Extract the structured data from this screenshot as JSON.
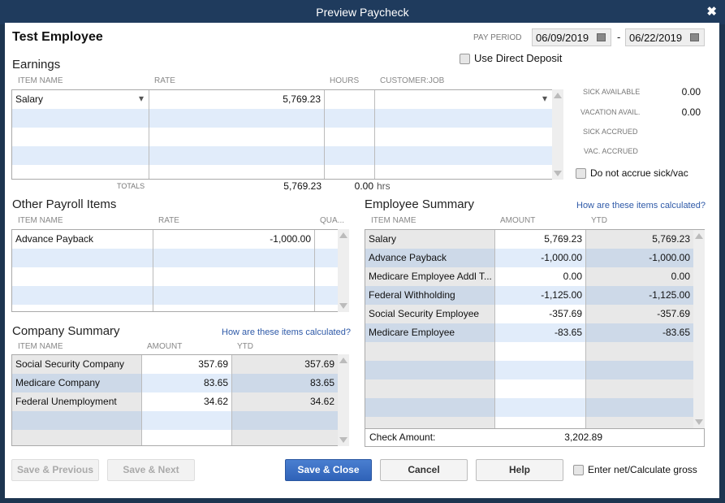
{
  "window": {
    "title": "Preview Paycheck",
    "close": "✖"
  },
  "employee_name": "Test Employee",
  "pay_period": {
    "label": "PAY PERIOD",
    "start": "06/09/2019",
    "sep": "-",
    "end": "06/22/2019"
  },
  "direct_deposit": {
    "label": "Use Direct Deposit",
    "checked": false
  },
  "earnings": {
    "title": "Earnings",
    "headers": [
      "ITEM NAME",
      "RATE",
      "HOURS",
      "CUSTOMER:JOB"
    ],
    "rows": [
      [
        "Salary",
        "5,769.23",
        "",
        ""
      ]
    ],
    "totals_label": "TOTALS",
    "total_rate": "5,769.23",
    "total_hours": "0.00",
    "hours_unit": "hrs"
  },
  "accruals": {
    "sick_available_label": "SICK AVAILABLE",
    "sick_available": "0.00",
    "vacation_avail_label": "VACATION AVAIL.",
    "vacation_avail": "0.00",
    "sick_accrued_label": "SICK ACCRUED",
    "vac_accrued_label": "VAC. ACCRUED",
    "do_not_accrue": "Do not accrue sick/vac"
  },
  "other_payroll": {
    "title": "Other Payroll Items",
    "headers": [
      "ITEM NAME",
      "RATE",
      "QUA..."
    ],
    "rows": [
      [
        "Advance Payback",
        "-1,000.00",
        ""
      ]
    ]
  },
  "company_summary": {
    "title": "Company Summary",
    "link": "How are these items calculated?",
    "headers": [
      "ITEM NAME",
      "AMOUNT",
      "YTD"
    ],
    "rows": [
      [
        "Social Security Company",
        "357.69",
        "357.69"
      ],
      [
        "Medicare Company",
        "83.65",
        "83.65"
      ],
      [
        "Federal Unemployment",
        "34.62",
        "34.62"
      ]
    ]
  },
  "employee_summary": {
    "title": "Employee Summary",
    "link": "How are these items calculated?",
    "headers": [
      "ITEM NAME",
      "AMOUNT",
      "YTD"
    ],
    "rows": [
      [
        "Salary",
        "5,769.23",
        "5,769.23"
      ],
      [
        "Advance Payback",
        "-1,000.00",
        "-1,000.00"
      ],
      [
        "Medicare Employee Addl T...",
        "0.00",
        "0.00"
      ],
      [
        "Federal Withholding",
        "-1,125.00",
        "-1,125.00"
      ],
      [
        "Social Security Employee",
        "-357.69",
        "-357.69"
      ],
      [
        "Medicare Employee",
        "-83.65",
        "-83.65"
      ]
    ],
    "check_amount_label": "Check Amount:",
    "check_amount": "3,202.89"
  },
  "buttons": {
    "save_previous": "Save & Previous",
    "save_next": "Save & Next",
    "save_close": "Save & Close",
    "cancel": "Cancel",
    "help": "Help"
  },
  "enter_net": {
    "label": "Enter net/Calculate gross",
    "checked": false
  }
}
